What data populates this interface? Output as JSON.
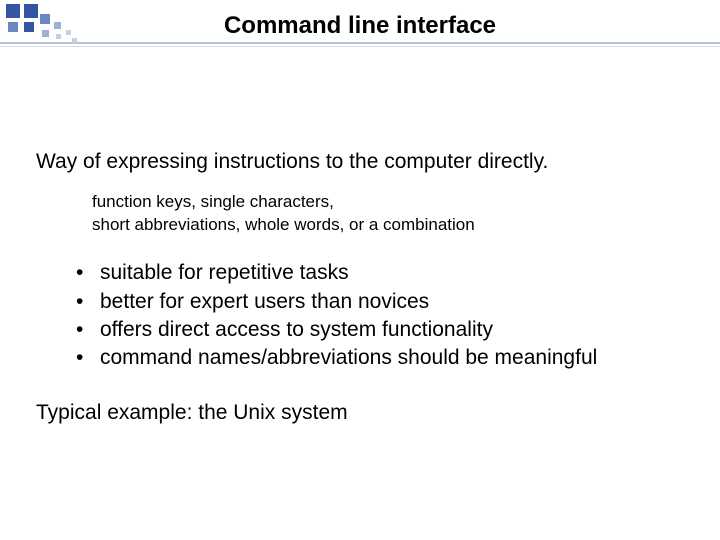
{
  "title": "Command line interface",
  "intro": "Way of expressing instructions to the computer directly.",
  "subnote_line1": "function keys, single characters,",
  "subnote_line2": "short abbreviations, whole words, or a combination",
  "bullets": [
    "suitable for repetitive tasks",
    "better for expert users than novices",
    "offers direct access to system functionality",
    "command names/abbreviations should be meaningful"
  ],
  "closing": "Typical example: the Unix system"
}
